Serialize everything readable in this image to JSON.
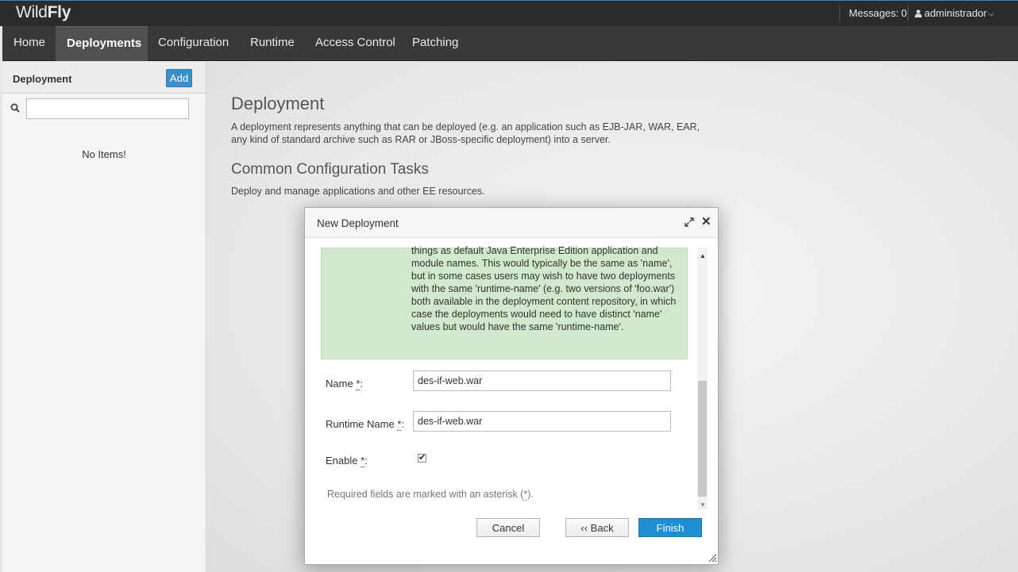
{
  "header": {
    "brand_light": "Wild",
    "brand_bold": "Fly",
    "messages_label": "Messages:",
    "messages_count": "0",
    "user_name": "administrador"
  },
  "nav": {
    "items": [
      "Home",
      "Deployments",
      "Configuration",
      "Runtime",
      "Access Control",
      "Patching"
    ],
    "active": "Deployments"
  },
  "sidebar": {
    "title": "Deployment",
    "add_label": "Add",
    "search_value": "",
    "empty_text": "No Items!"
  },
  "main": {
    "title": "Deployment",
    "description": "A deployment represents anything that can be deployed (e.g. an application such as EJB-JAR, WAR, EAR, any kind of standard archive such as RAR or JBoss-specific deployment) into a server.",
    "tasks_title": "Common Configuration Tasks",
    "tasks_description": "Deploy and manage applications and other EE resources."
  },
  "modal": {
    "title": "New Deployment",
    "help_text": "things as default Java Enterprise Edition application and module names. This would typically be the same as 'name', but in some cases users may wish to have two deployments with the same 'runtime-name' (e.g. two versions of 'foo.war') both available in the deployment content repository, in which case the deployments would need to have distinct 'name' values but would have the same 'runtime-name'.",
    "fields": {
      "name_label": "Name",
      "name_value": "des-if-web.war",
      "runtime_name_label": "Runtime Name",
      "runtime_name_value": "des-if-web.war",
      "enable_label": "Enable",
      "enable_checked": true,
      "required_star": "*"
    },
    "required_note_prefix": "Required fields are marked with an asterisk (",
    "required_note_star": "*",
    "required_note_suffix": ").",
    "buttons": {
      "cancel": "Cancel",
      "back": "‹‹ Back",
      "finish": "Finish"
    }
  },
  "colors": {
    "accent": "#1f8fd1",
    "help_background": "#d2e8cc"
  }
}
